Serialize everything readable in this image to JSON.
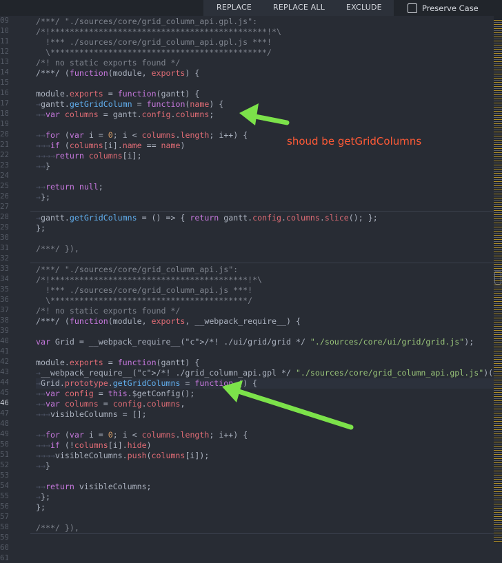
{
  "toolbar": {
    "replace": "REPLACE",
    "replace_all": "REPLACE ALL",
    "exclude": "EXCLUDE",
    "preserve_case": "Preserve Case"
  },
  "line_numbers": [
    "09",
    "10",
    "11",
    "12",
    "13",
    "14",
    "15",
    "16",
    "17",
    "18",
    "19",
    "20",
    "21",
    "22",
    "23",
    "24",
    "25",
    "26",
    "27",
    "28",
    "29",
    "30",
    "31",
    "32",
    "33",
    "34",
    "35",
    "36",
    "37",
    "38",
    "39",
    "40",
    "41",
    "42",
    "43",
    "44",
    "45",
    "46",
    "47",
    "48",
    "49",
    "50",
    "51",
    "52",
    "53",
    "54",
    "55",
    "56",
    "57",
    "58",
    "59",
    "60",
    "61"
  ],
  "current_line": "46",
  "code": [
    "/***/ \"./sources/core/grid_column_api.gpl.js\":",
    "/*!*********************************************!*\\",
    "  !*** ./sources/core/grid_column_api.gpl.js ***!",
    "  \\*********************************************/",
    "/*! no static exports found */",
    "/***/ (function(module, exports) {",
    "",
    "module.exports = function(gantt) {",
    "gantt.getGridColumn = function(name) {",
    "var columns = gantt.config.columns;",
    "",
    "for (var i = 0; i < columns.length; i++) {",
    "if (columns[i].name == name)",
    "return columns[i];",
    "}",
    "",
    "return null;",
    "};",
    "",
    "gantt.getGridColumns = () => { return gantt.config.columns.slice(); };",
    "};",
    "",
    "/***/ }),",
    "",
    "/***/ \"./sources/core/grid_column_api.js\":",
    "/*!*****************************************!*\\",
    "  !*** ./sources/core/grid_column_api.js ***!",
    "  \\*****************************************/",
    "/*! no static exports found */",
    "/***/ (function(module, exports, __webpack_require__) {",
    "",
    "var Grid = __webpack_require__(/*! ./ui/grid/grid */ \"./sources/core/ui/grid/grid.js\");",
    "",
    "module.exports = function(gantt) {",
    "__webpack_require__(/*! ./grid_column_api.gpl */ \"./sources/core/grid_column_api.gpl.js\")(gantt);",
    "Grid.prototype.getGridColumns = function () {",
    "var config = this.$getConfig();",
    "var columns = config.columns,",
    "visibleColumns = [];",
    "",
    "for (var i = 0; i < columns.length; i++) {",
    "if (!columns[i].hide)",
    "visibleColumns.push(columns[i]);",
    "}",
    "",
    "return visibleColumns;",
    "};",
    "};",
    "",
    "/***/ }),",
    ""
  ],
  "annotation": "shoud be getGridColumns",
  "colors": {
    "background": "#282c34",
    "keyword": "#c678dd",
    "function": "#61afef",
    "property": "#e06c75",
    "string": "#98c379",
    "comment": "#7f848e",
    "number": "#d19a66",
    "annotation": "#ff5a36",
    "arrow": "#7ce24a"
  }
}
